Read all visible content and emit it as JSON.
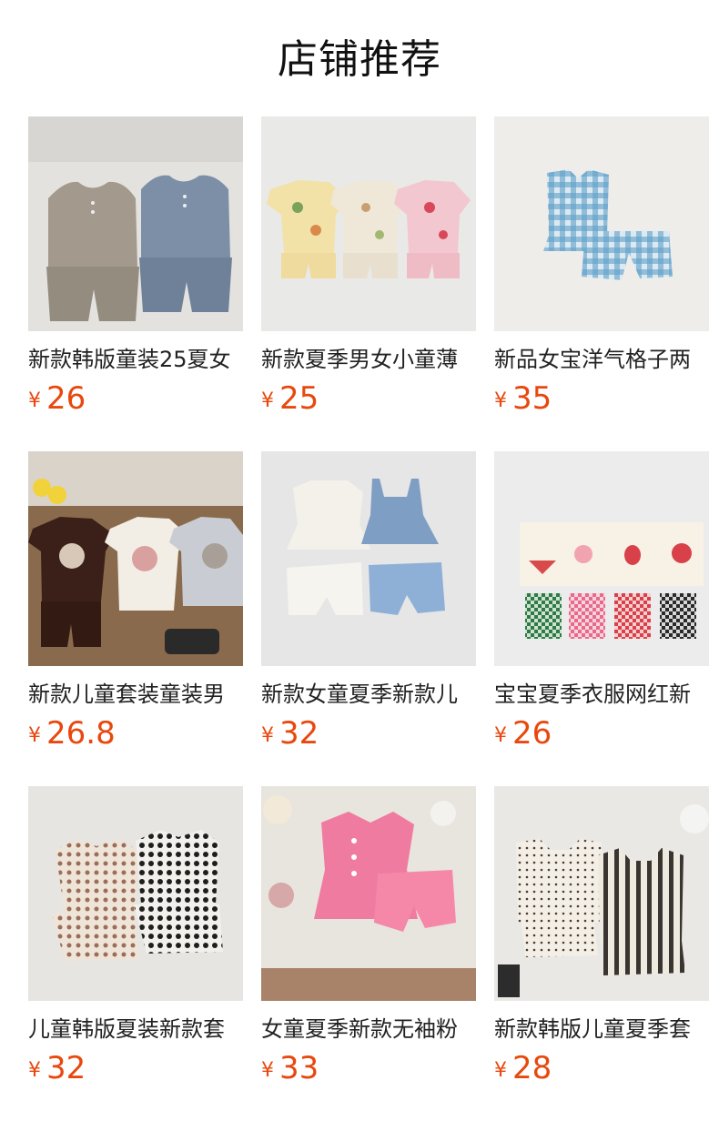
{
  "section_title": "店铺推荐",
  "currency_symbol": "¥",
  "accent_color": "#e8480e",
  "products": [
    {
      "name": "新款韩版童装25夏女",
      "price": "26",
      "image": "beige-and-blue-sleeveless-set-photo"
    },
    {
      "name": "新款夏季男女小童薄",
      "price": "25",
      "image": "printed-pajama-sets-photo"
    },
    {
      "name": "新品女宝洋气格子两",
      "price": "35",
      "image": "blue-gingham-ruffle-set-photo"
    },
    {
      "name": "新款儿童套装童装男",
      "price": "26.8",
      "image": "graphic-tee-sets-photo"
    },
    {
      "name": "新款女童夏季新款儿",
      "price": "32",
      "image": "white-and-denim-ruffle-sets-photo"
    },
    {
      "name": "宝宝夏季衣服网红新",
      "price": "26",
      "image": "fruit-tee-and-check-shorts-photo"
    },
    {
      "name": "儿童韩版夏装新款套",
      "price": "32",
      "image": "heart-print-ruffle-sets-photo"
    },
    {
      "name": "女童夏季新款无袖粉",
      "price": "33",
      "image": "pink-eyelet-set-photo"
    },
    {
      "name": "新款韩版儿童夏季套",
      "price": "28",
      "image": "polka-dot-and-stripe-sets-photo"
    }
  ]
}
